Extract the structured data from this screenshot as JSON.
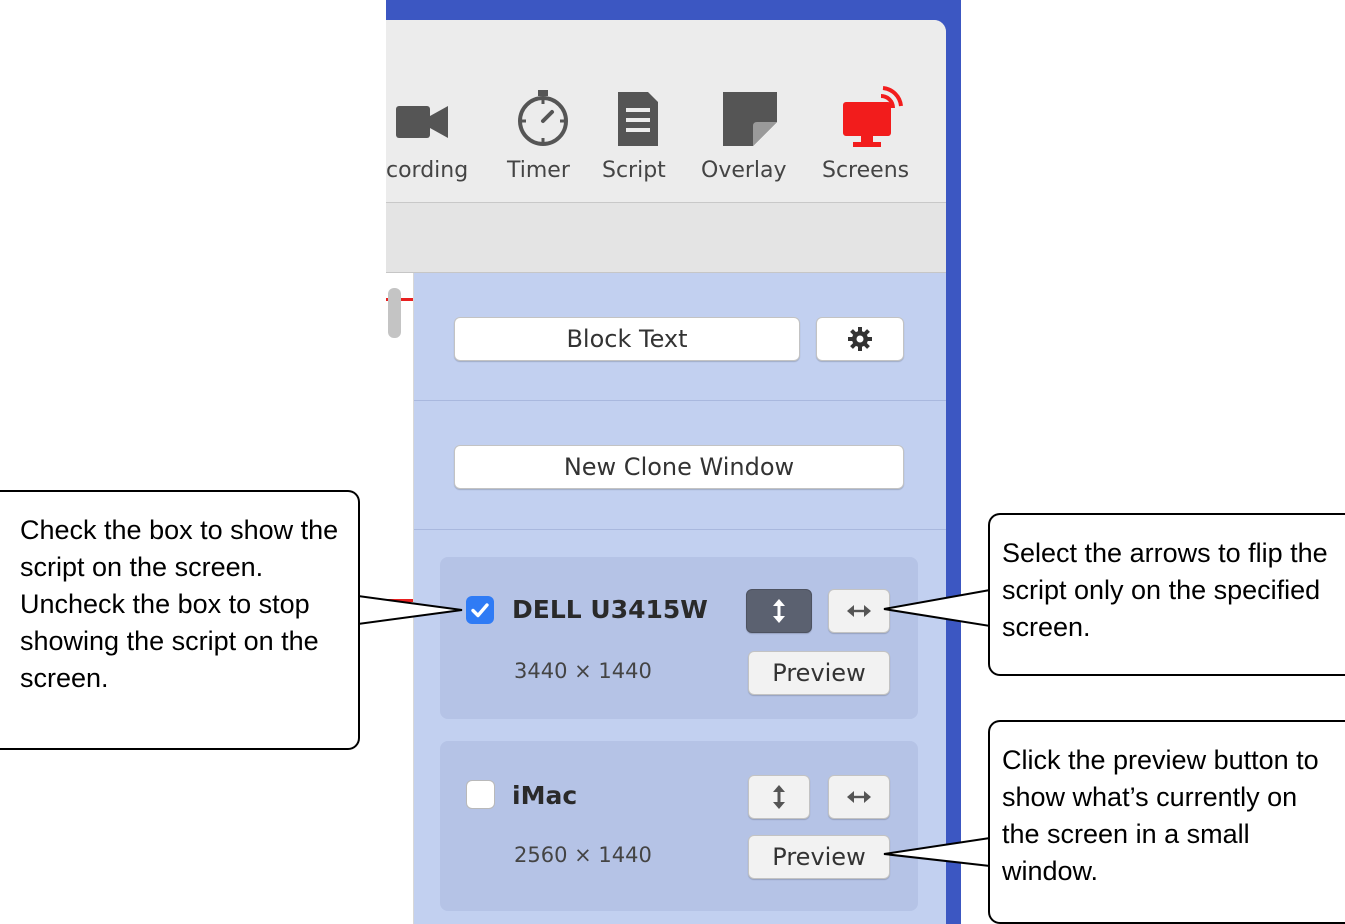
{
  "toolbar": {
    "items": [
      {
        "label": "cording",
        "icon": "video-camera-icon"
      },
      {
        "label": "Timer",
        "icon": "stopwatch-icon"
      },
      {
        "label": "Script",
        "icon": "document-icon"
      },
      {
        "label": "Overlay",
        "icon": "overlay-icon"
      },
      {
        "label": "Screens",
        "icon": "screens-broadcast-icon"
      }
    ],
    "active": "Screens",
    "active_color": "#f21c1c"
  },
  "panel": {
    "block_text_label": "Block Text",
    "settings_icon": "gear-icon",
    "new_clone_label": "New Clone Window",
    "screens": [
      {
        "name": "DELL U3415W",
        "resolution": "3440 × 1440",
        "checked": true,
        "preview_label": "Preview",
        "flip_vertical_active": true
      },
      {
        "name": "iMac",
        "resolution": "2560 × 1440",
        "checked": false,
        "preview_label": "Preview",
        "flip_vertical_active": false
      }
    ]
  },
  "callouts": {
    "checkbox": "Check the box to show the script on the screen. Uncheck the box to stop showing the script on the screen.",
    "arrows": "Select the arrows to flip the script only on the specified screen.",
    "preview": "Click the preview button to show what’s currently on the screen in a small window."
  },
  "colors": {
    "desktop": "#3c57c2",
    "panel": "#c2d0f0",
    "checkbox_on": "#2f7bf5"
  }
}
